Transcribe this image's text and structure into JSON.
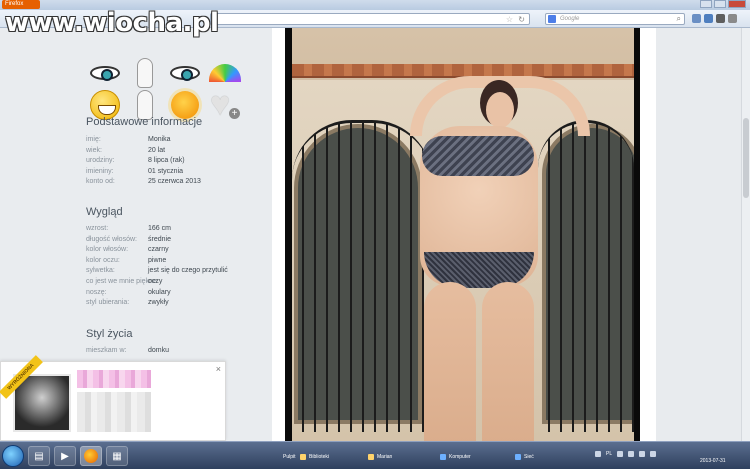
{
  "browser": {
    "tab_label": "Firefox",
    "search_placeholder": "Google"
  },
  "watermark": {
    "text": "www.wiocha.pl"
  },
  "sidebar": {
    "icons": [
      "eye-icon",
      "figure-icon",
      "eye-icon",
      "rainbow-icon",
      "smiley-icon",
      "figure-icon",
      "sun-icon",
      "heart-plus-icon"
    ],
    "basic": {
      "title": "Podstawowe informacje",
      "rows": [
        {
          "k": "imię:",
          "v": "Monika"
        },
        {
          "k": "wiek:",
          "v": "20 lat"
        },
        {
          "k": "urodziny:",
          "v": "8 lipca (rak)"
        },
        {
          "k": "imieniny:",
          "v": "01 stycznia"
        },
        {
          "k": "konto od:",
          "v": "25 czerwca 2013"
        }
      ]
    },
    "looks": {
      "title": "Wygląd",
      "rows": [
        {
          "k": "wzrost:",
          "v": "166 cm"
        },
        {
          "k": "długość włosów:",
          "v": "średnie"
        },
        {
          "k": "kolor włosów:",
          "v": "czarny"
        },
        {
          "k": "kolor oczu:",
          "v": "piwne"
        },
        {
          "k": "sylwetka:",
          "v": "jest się do czego przytulić"
        },
        {
          "k": "co jest we mnie piękne:",
          "v": "oczy"
        },
        {
          "k": "noszę:",
          "v": "okulary"
        },
        {
          "k": "styl ubierania:",
          "v": "zwykły"
        }
      ]
    },
    "lifestyle": {
      "title": "Styl życia",
      "rows": [
        {
          "k": "mieszkam w:",
          "v": "domku"
        }
      ]
    }
  },
  "popup": {
    "ribbon": "WYRÓŻNIONA",
    "close": "×"
  },
  "taskbar": {
    "items": [
      {
        "label": "Pulpit"
      },
      {
        "label": "Biblioteki"
      },
      {
        "label": "Marian"
      },
      {
        "label": "Komputer"
      },
      {
        "label": "Sieć"
      }
    ],
    "lang": "PL",
    "date": "2013-07-31"
  }
}
